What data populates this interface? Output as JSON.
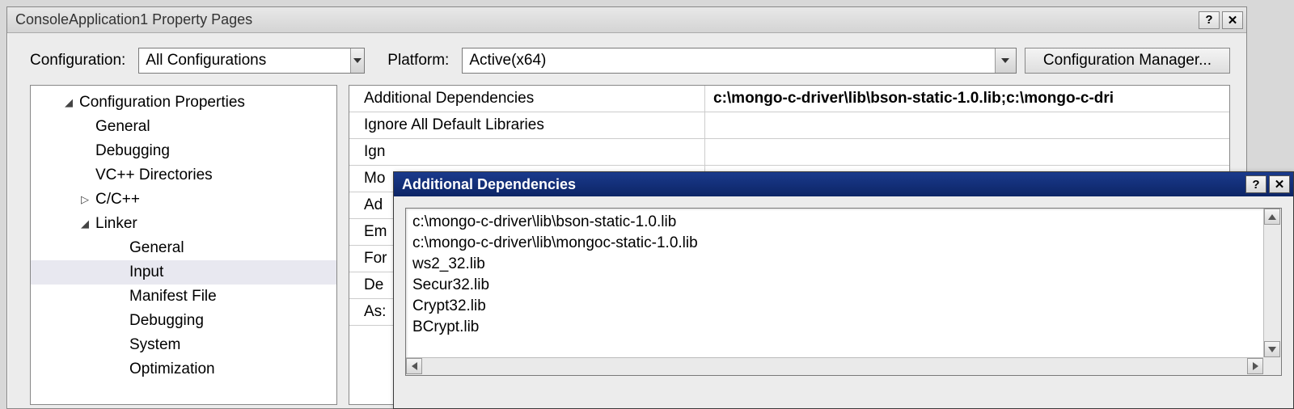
{
  "main_window": {
    "title": "ConsoleApplication1 Property Pages",
    "help_glyph": "?",
    "close_glyph": "✕",
    "config_label": "Configuration:",
    "config_value": "All Configurations",
    "platform_label": "Platform:",
    "platform_value": "Active(x64)",
    "config_mgr_label": "Configuration Manager..."
  },
  "tree": {
    "root": "Configuration Properties",
    "items": [
      "General",
      "Debugging",
      "VC++ Directories"
    ],
    "cpp": "C/C++",
    "linker": "Linker",
    "linker_children": [
      "General",
      "Input",
      "Manifest File",
      "Debugging",
      "System",
      "Optimization"
    ],
    "selected": "Input"
  },
  "grid": {
    "rows": [
      {
        "name": "Additional Dependencies",
        "value": "c:\\mongo-c-driver\\lib\\bson-static-1.0.lib;c:\\mongo-c-dri",
        "bold": true
      },
      {
        "name": "Ignore All Default Libraries",
        "value": ""
      },
      {
        "name": "Ign",
        "value": ""
      },
      {
        "name": "Mo",
        "value": ""
      },
      {
        "name": "Ad",
        "value": ""
      },
      {
        "name": "Em",
        "value": ""
      },
      {
        "name": "For",
        "value": ""
      },
      {
        "name": "De",
        "value": ""
      },
      {
        "name": "As:",
        "value": ""
      }
    ]
  },
  "dialog": {
    "title": "Additional Dependencies",
    "lines": [
      "c:\\mongo-c-driver\\lib\\bson-static-1.0.lib",
      "c:\\mongo-c-driver\\lib\\mongoc-static-1.0.lib",
      "ws2_32.lib",
      "Secur32.lib",
      "Crypt32.lib",
      "BCrypt.lib"
    ]
  }
}
